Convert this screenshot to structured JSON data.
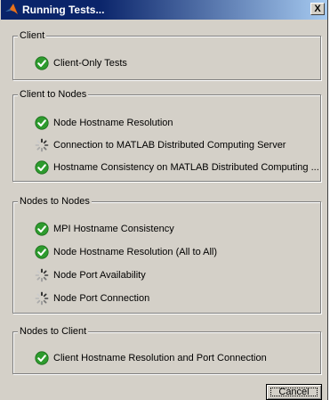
{
  "window": {
    "title": "Running Tests..."
  },
  "title_bar": {
    "close_label": "X"
  },
  "groups": [
    {
      "label": "Client",
      "items": [
        {
          "label": "Client-Only Tests",
          "status": "passed"
        }
      ]
    },
    {
      "label": "Client to Nodes",
      "items": [
        {
          "label": "Node Hostname Resolution",
          "status": "passed"
        },
        {
          "label": "Connection to MATLAB Distributed Computing Server",
          "status": "running"
        },
        {
          "label": "Hostname Consistency on MATLAB Distributed Computing ...",
          "status": "passed"
        }
      ]
    },
    {
      "label": "Nodes to Nodes",
      "items": [
        {
          "label": "MPI Hostname Consistency",
          "status": "passed"
        },
        {
          "label": "Node Hostname Resolution (All to All)",
          "status": "passed"
        },
        {
          "label": "Node Port Availability",
          "status": "running"
        },
        {
          "label": "Node Port Connection",
          "status": "running"
        }
      ]
    },
    {
      "label": "Nodes to Client",
      "items": [
        {
          "label": "Client Hostname Resolution and Port Connection",
          "status": "passed"
        }
      ]
    }
  ],
  "buttons": {
    "cancel_label": "Cancel"
  },
  "colors": {
    "title_bar_start": "#0a246a",
    "title_bar_end": "#a6caf0",
    "dialog_background": "#d4d0c8",
    "passed_icon": "#2e9b2e"
  },
  "icons": {
    "passed": "check-circle-icon",
    "running": "spinner-icon",
    "app": "matlab-logo-icon"
  }
}
